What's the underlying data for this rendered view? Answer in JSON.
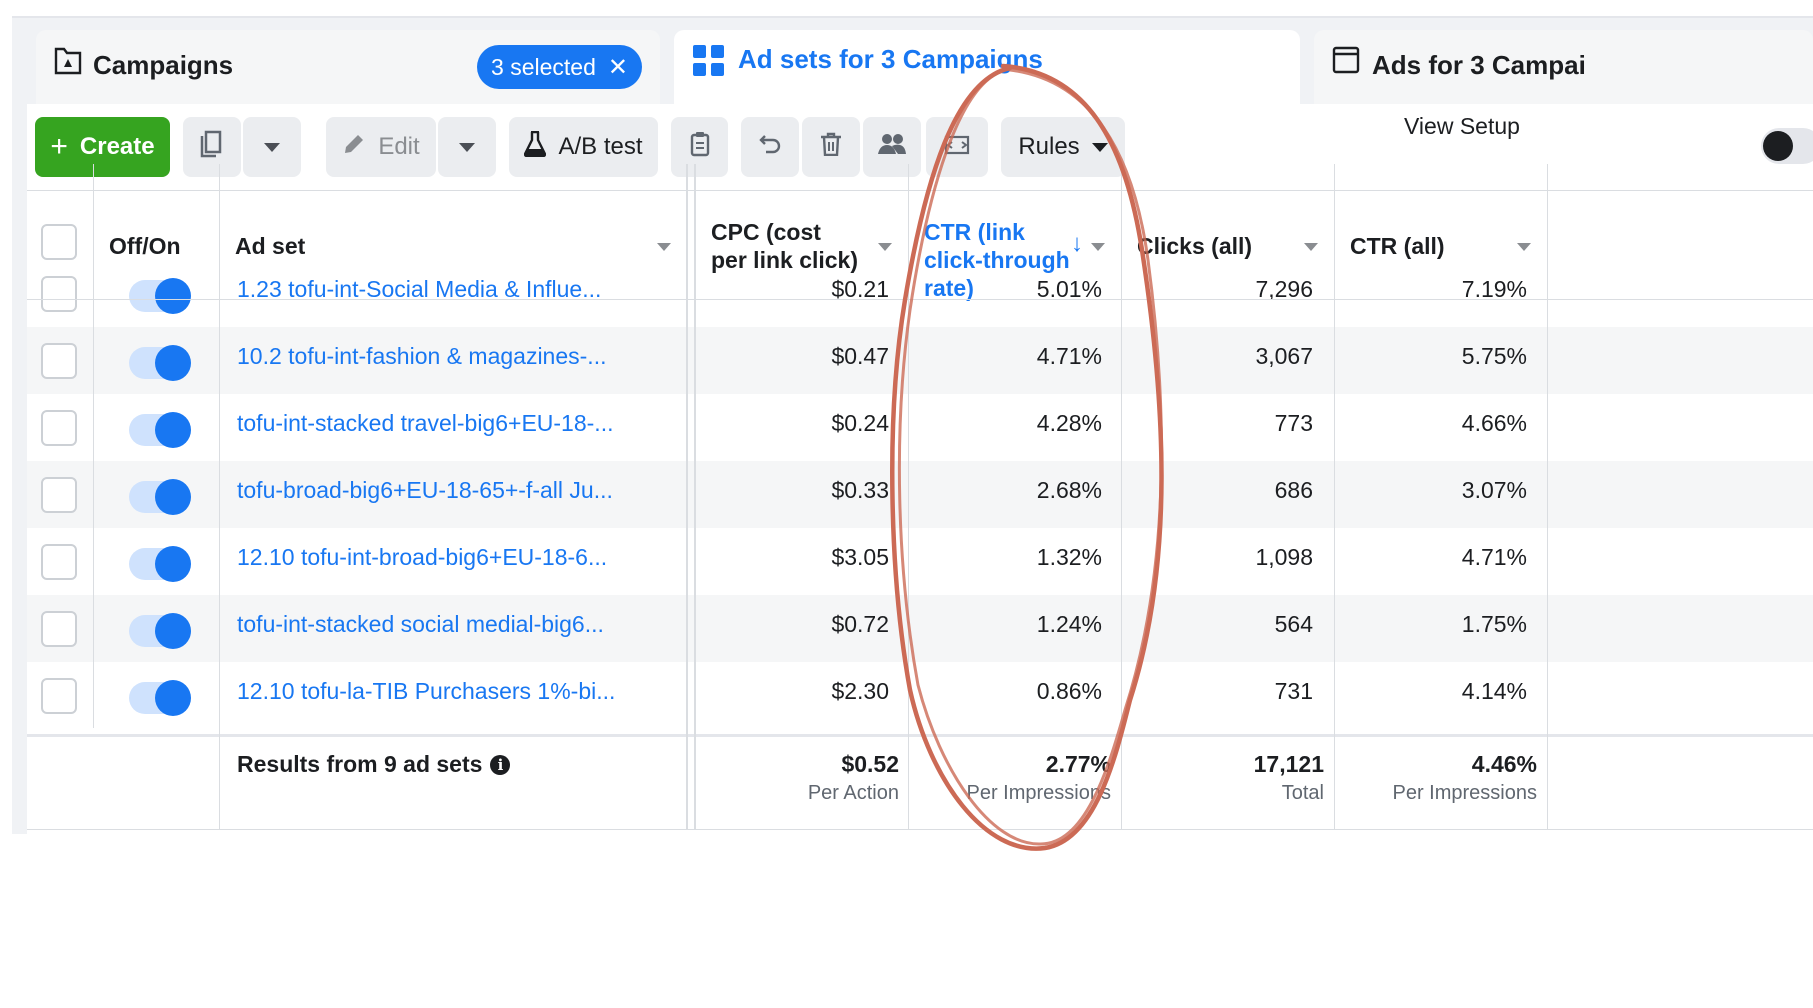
{
  "tabs": [
    {
      "label": "Campaigns",
      "icon": "campaign-flag-icon",
      "badge": "3 selected"
    },
    {
      "label": "Ad sets for 3 Campaigns",
      "icon": "grid-icon",
      "active": true
    },
    {
      "label": "Ads for 3 Campai",
      "icon": "window-icon"
    }
  ],
  "toolbar": {
    "create_label": "Create",
    "edit_label": "Edit",
    "ab_test_label": "A/B test",
    "rules_label": "Rules",
    "view_setup_label": "View Setup"
  },
  "table": {
    "columns": {
      "off_on": "Off/On",
      "ad_set": "Ad set",
      "cpc": "CPC (cost per link click)",
      "ctr_link": "CTR (link click-through rate)",
      "clicks": "Clicks (all)",
      "ctr_all": "CTR (all)"
    },
    "rows": [
      {
        "name": "1.23 tofu-int-Social Media & Influe...",
        "cpc": "$0.21",
        "ctr_link": "5.01%",
        "clicks": "7,296",
        "ctr_all": "7.19%",
        "on": true
      },
      {
        "name": "10.2 tofu-int-fashion & magazines-...",
        "cpc": "$0.47",
        "ctr_link": "4.71%",
        "clicks": "3,067",
        "ctr_all": "5.75%",
        "on": true
      },
      {
        "name": "tofu-int-stacked travel-big6+EU-18-...",
        "cpc": "$0.24",
        "ctr_link": "4.28%",
        "clicks": "773",
        "ctr_all": "4.66%",
        "on": true
      },
      {
        "name": "tofu-broad-big6+EU-18-65+-f-all Ju...",
        "cpc": "$0.33",
        "ctr_link": "2.68%",
        "clicks": "686",
        "ctr_all": "3.07%",
        "on": true
      },
      {
        "name": "12.10 tofu-int-broad-big6+EU-18-6...",
        "cpc": "$3.05",
        "ctr_link": "1.32%",
        "clicks": "1,098",
        "ctr_all": "4.71%",
        "on": true
      },
      {
        "name": "tofu-int-stacked social medial-big6...",
        "cpc": "$0.72",
        "ctr_link": "1.24%",
        "clicks": "564",
        "ctr_all": "1.75%",
        "on": true
      },
      {
        "name": "12.10 tofu-la-TIB Purchasers 1%-bi...",
        "cpc": "$2.30",
        "ctr_link": "0.86%",
        "clicks": "731",
        "ctr_all": "4.14%",
        "on": true
      }
    ],
    "footer": {
      "label": "Results from 9 ad sets",
      "cpc": "$0.52",
      "cpc_sub": "Per Action",
      "ctr_link": "2.77%",
      "ctr_link_sub": "Per Impressions",
      "clicks": "17,121",
      "clicks_sub": "Total",
      "ctr_all": "4.46%",
      "ctr_all_sub": "Per Impressions"
    }
  },
  "colors": {
    "accent": "#1877f2",
    "create_green": "#36a420",
    "annotation": "#cc6a55"
  }
}
